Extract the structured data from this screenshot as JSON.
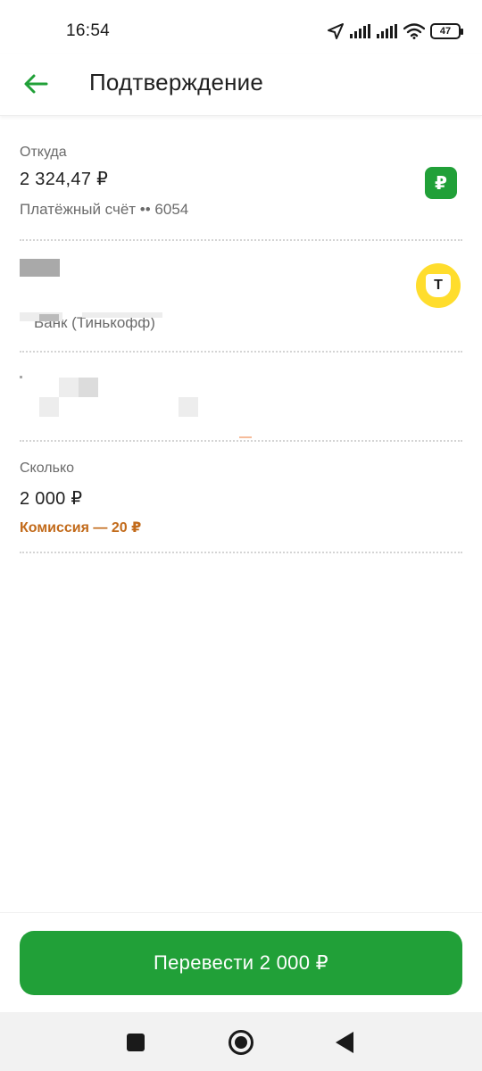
{
  "status_bar": {
    "time": "16:54",
    "battery": "47",
    "icons": [
      "location-arrow-icon",
      "signal-icon",
      "signal-icon",
      "wifi-icon",
      "battery-icon"
    ]
  },
  "header": {
    "back_icon": "arrow-left-icon",
    "title": "Подтверждение"
  },
  "from": {
    "label": "Откуда",
    "balance": "2 324,47 ₽",
    "account": "Платёжный счёт •• 6054",
    "badge": "₽"
  },
  "recipient": {
    "bank": "Банк (Тинькофф)",
    "bank_logo_letter": "Т",
    "bank_logo_color": "#ffdd2d"
  },
  "amount": {
    "label": "Сколько",
    "value": "2 000 ₽",
    "commission": "Комиссия — 20 ₽"
  },
  "actions": {
    "transfer_label": "Перевести 2 000 ₽"
  },
  "colors": {
    "brand_green": "#21a038",
    "commission_orange": "#c26a1a",
    "bank_yellow": "#ffdd2d"
  },
  "nav": {
    "icons": [
      "square-recents-icon",
      "circle-home-icon",
      "triangle-back-icon"
    ]
  }
}
